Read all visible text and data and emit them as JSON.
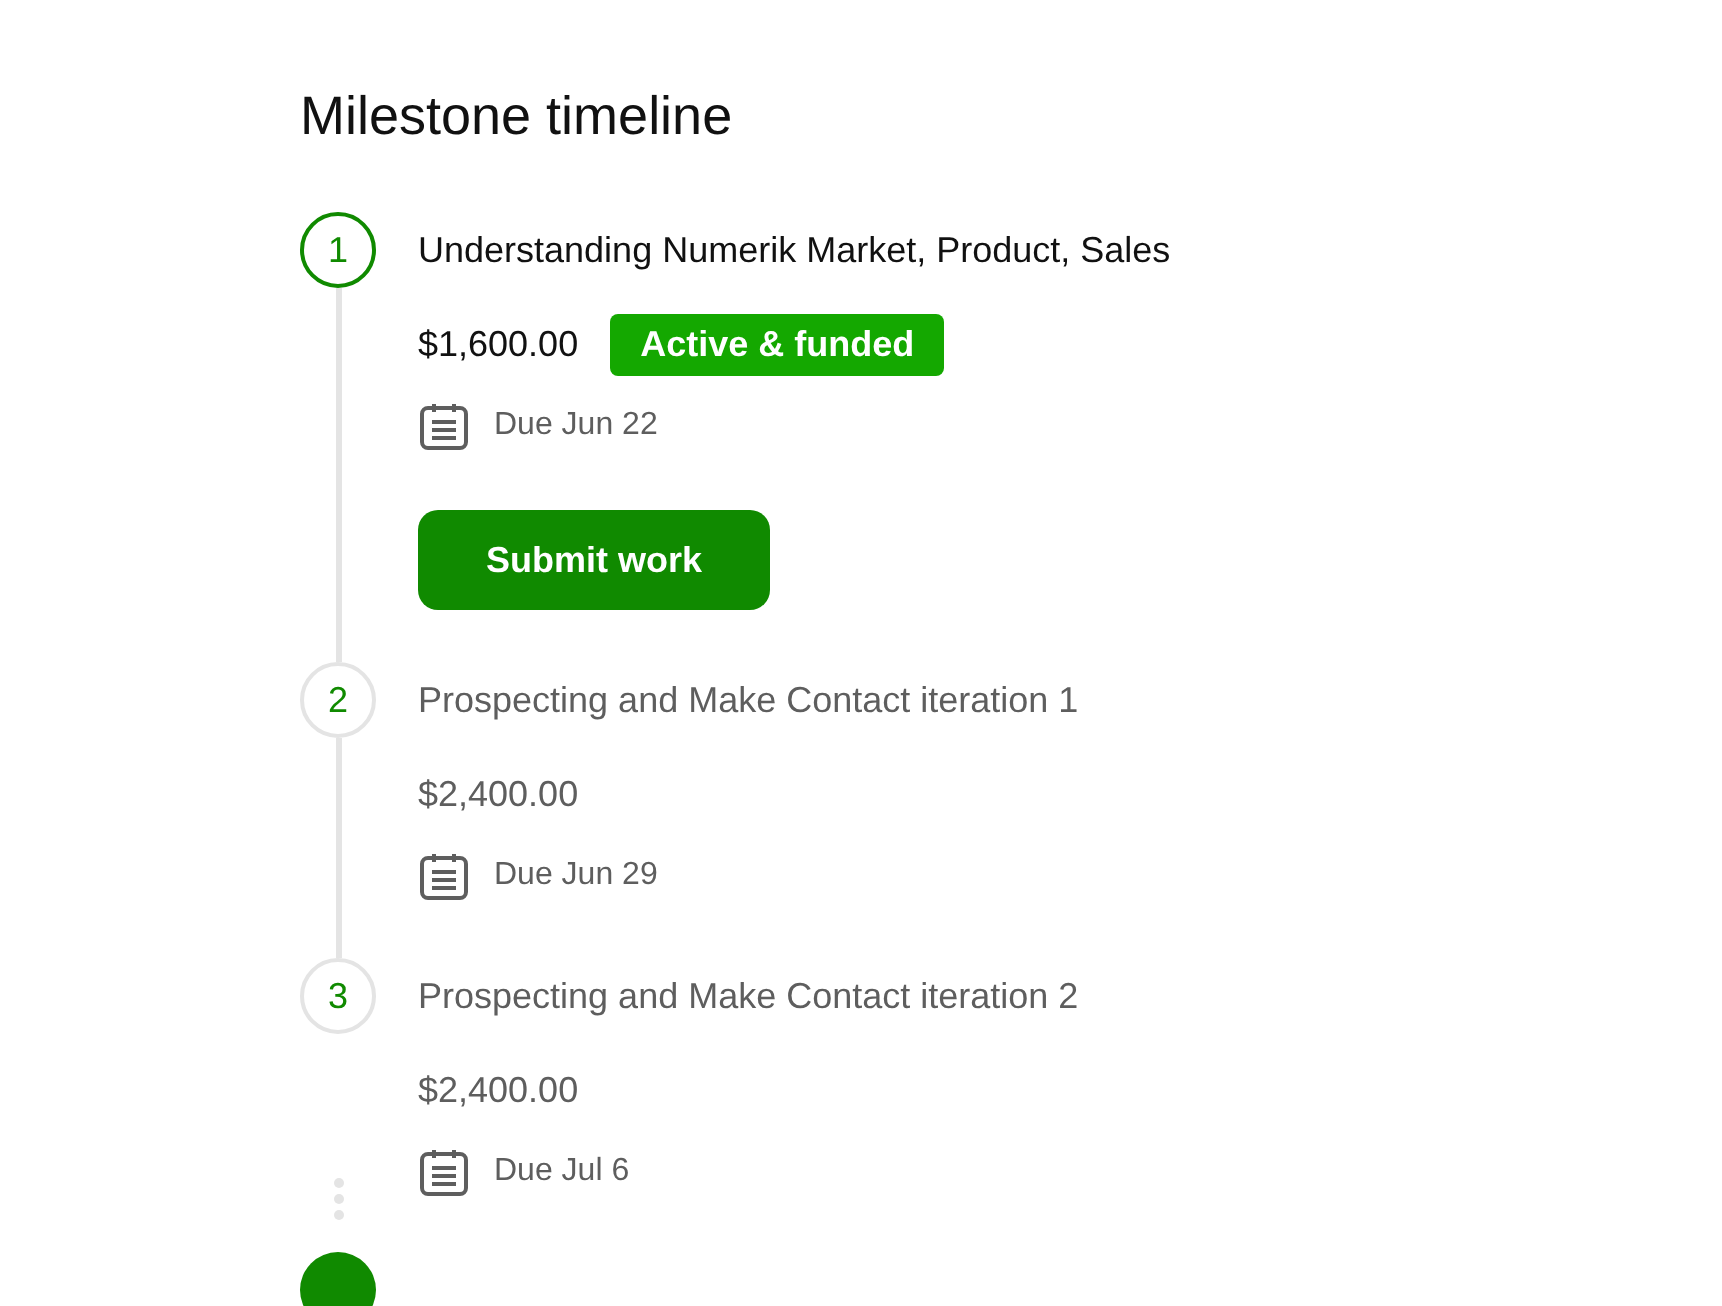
{
  "heading": "Milestone timeline",
  "milestones": [
    {
      "number": "1",
      "title": "Understanding Numerik Market, Product, Sales",
      "amount": "$1,600.00",
      "active": true,
      "badge": "Active & funded",
      "due": "Due Jun 22",
      "button": "Submit work"
    },
    {
      "number": "2",
      "title": "Prospecting and Make Contact iteration 1",
      "amount": "$2,400.00",
      "active": false,
      "due": "Due Jun 29"
    },
    {
      "number": "3",
      "title": "Prospecting and Make Contact iteration 2",
      "amount": "$2,400.00",
      "active": false,
      "due": "Due Jul 6"
    }
  ]
}
